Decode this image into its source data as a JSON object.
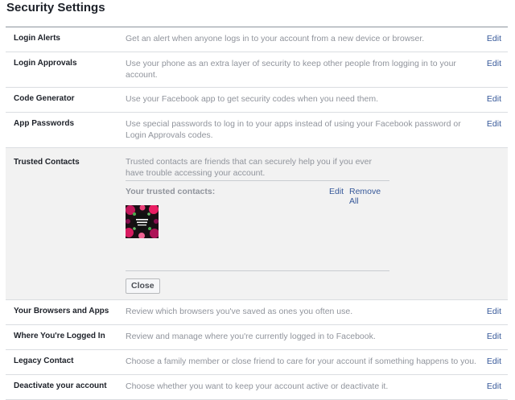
{
  "page": {
    "title": "Security Settings"
  },
  "rows_top": [
    {
      "label": "Login Alerts",
      "description": "Get an alert when anyone logs in to your account from a new device or browser.",
      "edit": "Edit"
    },
    {
      "label": "Login Approvals",
      "description": "Use your phone as an extra layer of security to keep other people from logging in to your account.",
      "edit": "Edit"
    },
    {
      "label": "Code Generator",
      "description": "Use your Facebook app to get security codes when you need them.",
      "edit": "Edit"
    },
    {
      "label": "App Passwords",
      "description": "Use special passwords to log in to your apps instead of using your Facebook password or Login Approvals codes.",
      "edit": "Edit"
    }
  ],
  "trusted_contacts": {
    "label": "Trusted Contacts",
    "description": "Trusted contacts are friends that can securely help you if you ever have trouble accessing your account.",
    "list_label": "Your trusted contacts:",
    "edit": "Edit",
    "remove_all": "Remove All",
    "contacts": [
      {
        "avatar": "floral-book-cover",
        "avatar_text": "APS BOOK"
      }
    ],
    "close": "Close"
  },
  "rows_bottom": [
    {
      "label": "Your Browsers and Apps",
      "description": "Review which browsers you've saved as ones you often use.",
      "edit": "Edit"
    },
    {
      "label": "Where You're Logged In",
      "description": "Review and manage where you're currently logged in to Facebook.",
      "edit": "Edit"
    },
    {
      "label": "Legacy Contact",
      "description": "Choose a family member or close friend to care for your account if something happens to you.",
      "edit": "Edit"
    },
    {
      "label": "Deactivate your account",
      "description": "Choose whether you want to keep your account active or deactivate it.",
      "edit": "Edit"
    }
  ],
  "colors": {
    "link": "#365899",
    "muted_text": "#90949c",
    "expanded_bg": "#f2f2f2"
  }
}
